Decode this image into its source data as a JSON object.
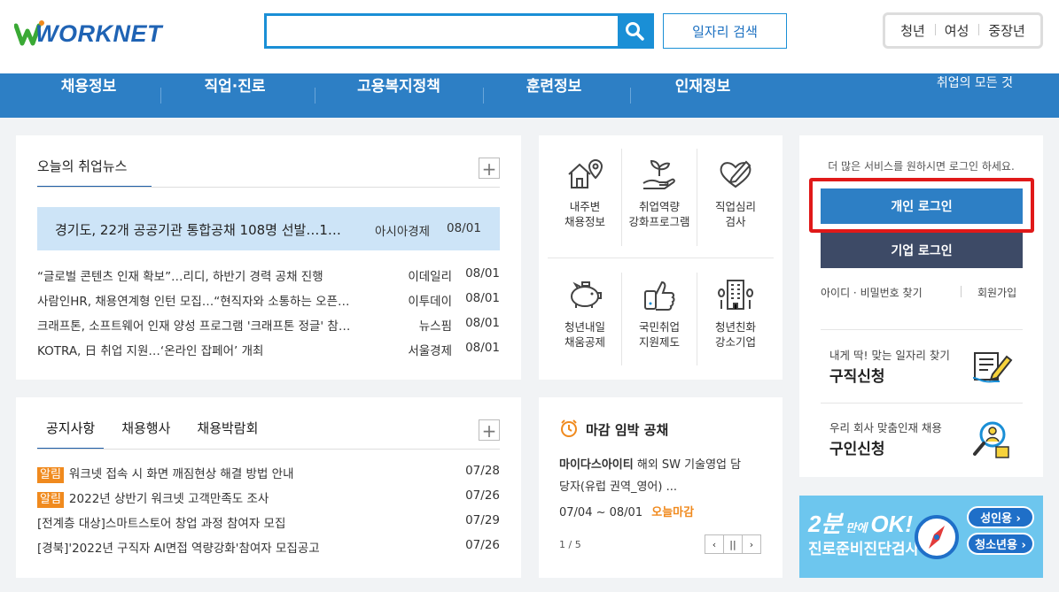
{
  "brand": {
    "logo_text": "WORKNET"
  },
  "header": {
    "search_placeholder": "",
    "job_search_label": "일자리 검색",
    "age_tabs": [
      "청년",
      "여성",
      "중장년"
    ]
  },
  "nav": {
    "items": [
      "채용정보",
      "직업·진로",
      "고용복지정책",
      "훈련정보",
      "인재정보"
    ],
    "all_label": "취업의 모든 것"
  },
  "news": {
    "tab_label": "오늘의 취업뉴스",
    "plus": "+",
    "highlight": {
      "title": "경기도, 22개 공공기관 통합공채 108명 선발…1…",
      "source": "아시아경제",
      "date": "08/01"
    },
    "rows": [
      {
        "title": "“글로벌 콘텐츠 인재 확보”…리디, 하반기 경력 공채 진행",
        "source": "이데일리",
        "date": "08/01"
      },
      {
        "title": "사람인HR, 채용연계형 인턴 모집…“현직자와 소통하는 오픈…",
        "source": "이투데이",
        "date": "08/01"
      },
      {
        "title": "크래프톤, 소프트웨어 인재 양성 프로그램 '크래프톤 정글' 참…",
        "source": "뉴스핌",
        "date": "08/01"
      },
      {
        "title": "KOTRA, 日 취업 지원…‘온라인 잡페어’ 개최",
        "source": "서울경제",
        "date": "08/01"
      }
    ]
  },
  "services": [
    {
      "line1": "내주변",
      "line2": "채용정보",
      "icon": "house-pin-icon"
    },
    {
      "line1": "취업역량",
      "line2": "강화프로그램",
      "icon": "hand-sprout-icon"
    },
    {
      "line1": "직업심리",
      "line2": "검사",
      "icon": "heart-pen-icon"
    },
    {
      "line1": "청년내일",
      "line2": "채움공제",
      "icon": "piggy-bank-icon"
    },
    {
      "line1": "국민취업",
      "line2": "지원제도",
      "icon": "thumbs-up-icon"
    },
    {
      "line1": "청년친화",
      "line2": "강소기업",
      "icon": "building-icon"
    }
  ],
  "notice": {
    "tabs": [
      "공지사항",
      "채용행사",
      "채용박람회"
    ],
    "plus": "+",
    "rows": [
      {
        "badge": "알림",
        "title": "워크넷 접속 시 화면 깨짐현상 해결 방법 안내",
        "date": "07/28"
      },
      {
        "badge": "알림",
        "title": "2022년 상반기 워크넷 고객만족도 조사",
        "date": "07/26"
      },
      {
        "badge": "",
        "title": "[전계층 대상]스마트스토어 창업 과정 참여자 모집",
        "date": "07/29"
      },
      {
        "badge": "",
        "title": "[경북]'2022년 구직자 AI면접 역량강화'참여자 모집공고",
        "date": "07/26"
      }
    ]
  },
  "deadline": {
    "title": "마감 임박 공채",
    "company": "마이다스아이티",
    "desc1": "해외 SW 기술영업 담",
    "desc2": "당자(유럽 권역_영어) ...",
    "period": "07/04 ~ 08/01",
    "status": "오늘마감",
    "page": "1 / 5",
    "prev": "‹",
    "pause": "||",
    "next": "›"
  },
  "login": {
    "info": "더 많은 서비스를 원하시면 로그인 하세요.",
    "personal_label": "개인 로그인",
    "company_label": "기업 로그인",
    "find_label": "아이디 · 비밀번호 찾기",
    "join_label": "회원가입",
    "seeker_sub": "내게 딱! 맞는 일자리 찾기",
    "seeker_title": "구직신청",
    "employer_sub": "우리 회사 맞춤인재 채용",
    "employer_title": "구인신청"
  },
  "banner": {
    "big": "2분",
    "mid": "만에",
    "ok": "OK!",
    "sub": "진로준비진단검사",
    "adult": "성인용 ›",
    "youth": "청소년용 ›"
  },
  "colors": {
    "nav": "#2d7fc5",
    "accent": "#1a8fd6",
    "badge": "#f08a1e",
    "company_btn": "#3d4a66"
  }
}
